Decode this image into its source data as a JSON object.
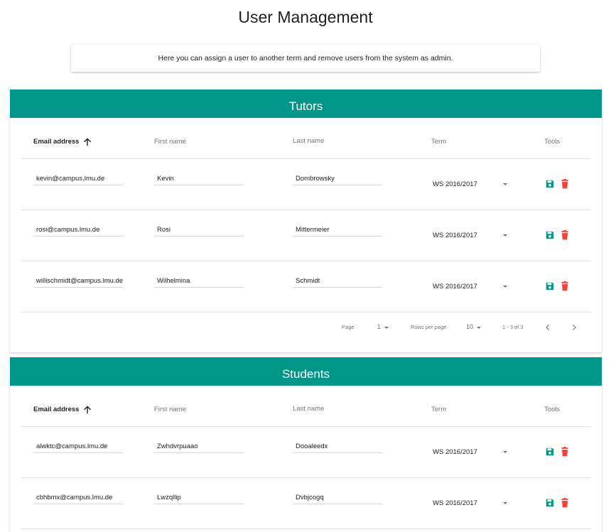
{
  "page": {
    "title": "User Management",
    "info": "Here you can assign a user to another term and remove users from the system as admin."
  },
  "columns": {
    "email": "Email address",
    "first_name": "First name",
    "last_name": "Last name",
    "term": "Term",
    "tools": "Tools"
  },
  "tutors": {
    "title": "Tutors",
    "rows": [
      {
        "email": "kevin@campus.lmu.de",
        "first_name": "Kevin",
        "last_name": "Dombrowsky",
        "term": "WS 2016/2017"
      },
      {
        "email": "rosi@campus.lmu.de",
        "first_name": "Rosi",
        "last_name": "Mittermeier",
        "term": "WS 2016/2017"
      },
      {
        "email": "willischmidt@campus.lmu.de",
        "first_name": "Wilhelmina",
        "last_name": "Schmidt",
        "term": "WS 2016/2017"
      }
    ],
    "pagination": {
      "page_label": "Page",
      "page_value": "1",
      "rows_label": "Rows per page",
      "rows_value": "10",
      "range": "1 - 3 of 3"
    }
  },
  "students": {
    "title": "Students",
    "rows": [
      {
        "email": "alwktc@campus.lmu.de",
        "first_name": "Zwhdvrpuaao",
        "last_name": "Dooaleedx",
        "term": "WS 2016/2017"
      },
      {
        "email": "cbhbmx@campus.lmu.de",
        "first_name": "Lwzqllip",
        "last_name": "Dvbjcogq",
        "term": "WS 2016/2017"
      }
    ]
  },
  "colors": {
    "header": "#009688",
    "save": "#009688",
    "delete": "#f44336"
  },
  "icons": {
    "sort": "arrow-up-icon",
    "save": "save-icon",
    "delete": "delete-icon",
    "prev": "chevron-left-icon",
    "next": "chevron-right-icon"
  }
}
